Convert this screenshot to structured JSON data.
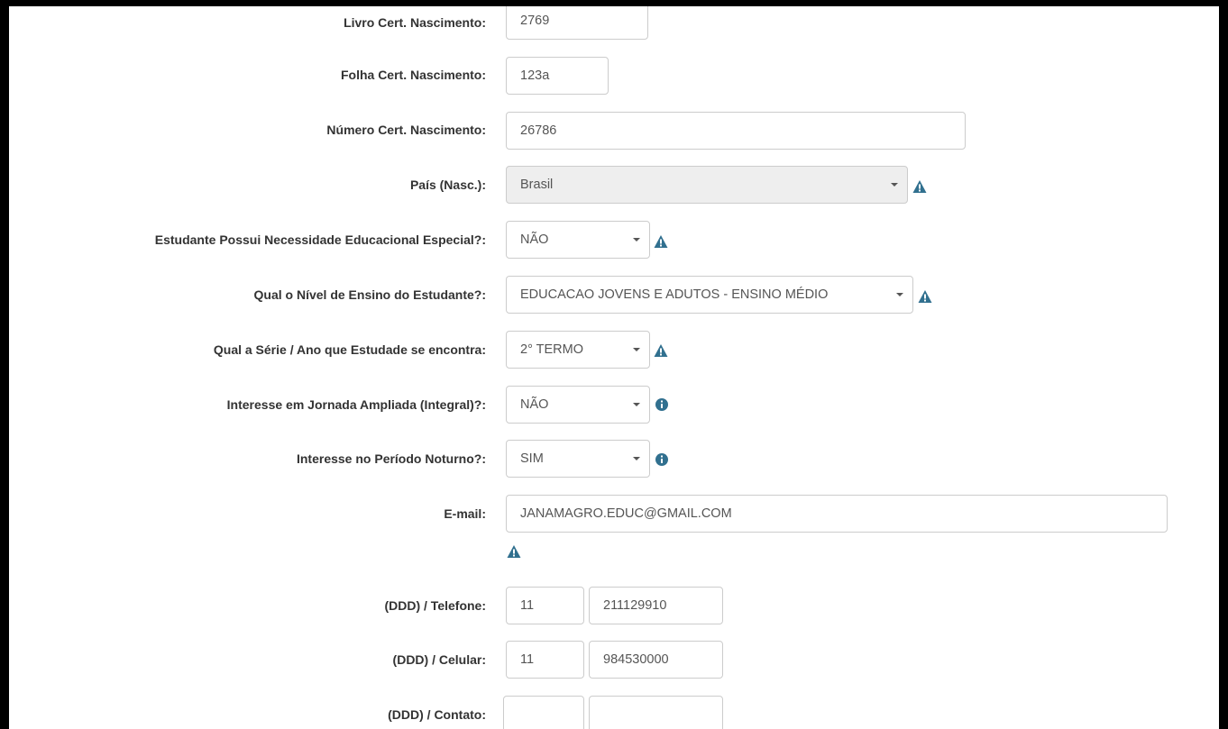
{
  "form": {
    "livro_cert": {
      "label": "Livro Cert. Nascimento:",
      "value": "2769"
    },
    "folha_cert": {
      "label": "Folha Cert. Nascimento:",
      "value": "123a"
    },
    "numero_cert": {
      "label": "Número Cert. Nascimento:",
      "value": "26786"
    },
    "pais_nasc": {
      "label": "País (Nasc.):",
      "value": "Brasil",
      "icon": "warning-icon"
    },
    "necessidade_especial": {
      "label": "Estudante Possui Necessidade Educacional Especial?:",
      "value": "NÃO",
      "icon": "warning-icon"
    },
    "nivel_ensino": {
      "label": "Qual o Nível de Ensino do Estudante?:",
      "value": "EDUCACAO JOVENS E ADUTOS - ENSINO MÉDIO",
      "icon": "warning-icon"
    },
    "serie_ano": {
      "label": "Qual a Série / Ano que Estudade se encontra:",
      "value": "2° TERMO",
      "icon": "warning-icon"
    },
    "jornada_ampliada": {
      "label": "Interesse em Jornada Ampliada (Integral)?:",
      "value": "NÃO",
      "icon": "info-icon"
    },
    "periodo_noturno": {
      "label": "Interesse no Período Noturno?:",
      "value": "SIM",
      "icon": "info-icon"
    },
    "email": {
      "label": "E-mail:",
      "value": "JANAMAGRO.EDUC@GMAIL.COM",
      "icon": "warning-icon"
    },
    "telefone": {
      "label": "(DDD) / Telefone:",
      "ddd": "11",
      "number": "211129910"
    },
    "celular": {
      "label": "(DDD) / Celular:",
      "ddd": "11",
      "number": "984530000"
    },
    "contato": {
      "label": "(DDD) / Contato:",
      "ddd": "",
      "number": ""
    }
  },
  "colors": {
    "icon": "#31708f",
    "label": "#333333",
    "input_text": "#555555",
    "border": "#cccccc",
    "disabled_bg": "#eeeeee"
  }
}
